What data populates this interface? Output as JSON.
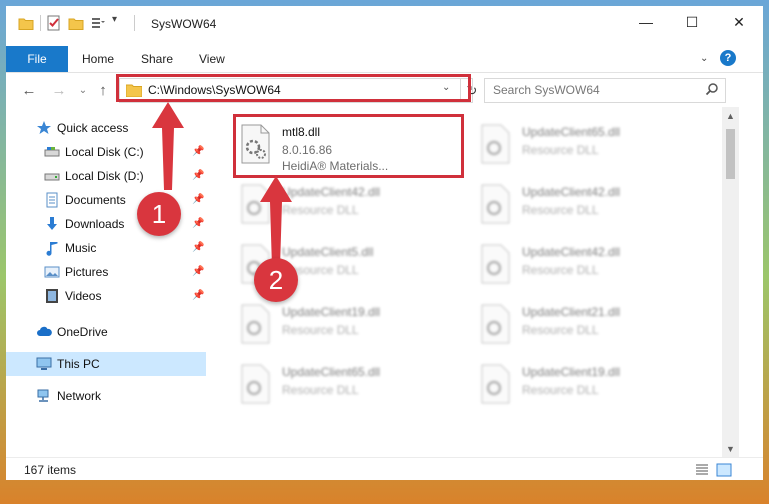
{
  "window": {
    "title": "SysWOW64",
    "controls": {
      "minimize": "—",
      "maximize": "☐",
      "close": "✕"
    }
  },
  "ribbon": {
    "file": "File",
    "tabs": [
      "Home",
      "Share",
      "View"
    ]
  },
  "navigation": {
    "address": "C:\\Windows\\SysWOW64",
    "search_placeholder": "Search SysWOW64"
  },
  "sidebar": {
    "items": [
      {
        "label": "Quick access",
        "icon": "star-icon",
        "pinned": false
      },
      {
        "label": "Local Disk (C:)",
        "icon": "drive-icon",
        "pinned": true
      },
      {
        "label": "Local Disk (D:)",
        "icon": "drive-icon",
        "pinned": true
      },
      {
        "label": "Documents",
        "icon": "documents-icon",
        "pinned": true
      },
      {
        "label": "Downloads",
        "icon": "download-icon",
        "pinned": true
      },
      {
        "label": "Music",
        "icon": "music-icon",
        "pinned": true
      },
      {
        "label": "Pictures",
        "icon": "pictures-icon",
        "pinned": true
      },
      {
        "label": "Videos",
        "icon": "videos-icon",
        "pinned": true
      },
      {
        "label": "OneDrive",
        "icon": "cloud-icon",
        "pinned": false
      },
      {
        "label": "This PC",
        "icon": "computer-icon",
        "pinned": false,
        "selected": true
      },
      {
        "label": "Network",
        "icon": "network-icon",
        "pinned": false
      }
    ]
  },
  "files": {
    "highlighted": {
      "name": "mtl8.dll",
      "version": "8.0.16.86",
      "company": "HeidiA® Materials..."
    },
    "left_column": [
      {
        "name": "UpdateClient42.dll",
        "type": "Resource DLL"
      },
      {
        "name": "UpdateClient5.dll",
        "type": "Resource DLL"
      },
      {
        "name": "UpdateClient19.dll",
        "type": "Resource DLL"
      },
      {
        "name": "UpdateClient65.dll",
        "type": "Resource DLL"
      }
    ],
    "right_column": [
      {
        "name": "UpdateClient65.dll",
        "type": "Resource DLL"
      },
      {
        "name": "UpdateClient42.dll",
        "type": "Resource DLL"
      },
      {
        "name": "UpdateClient42.dll",
        "type": "Resource DLL"
      },
      {
        "name": "UpdateClient21.dll",
        "type": "Resource DLL"
      },
      {
        "name": "UpdateClient19.dll",
        "type": "Resource DLL"
      }
    ]
  },
  "status": {
    "item_count": "167 items"
  },
  "annotations": {
    "step1": "1",
    "step2": "2"
  },
  "colors": {
    "accent": "#1979ca",
    "highlight": "#d0303b",
    "selected": "#cce8ff"
  }
}
